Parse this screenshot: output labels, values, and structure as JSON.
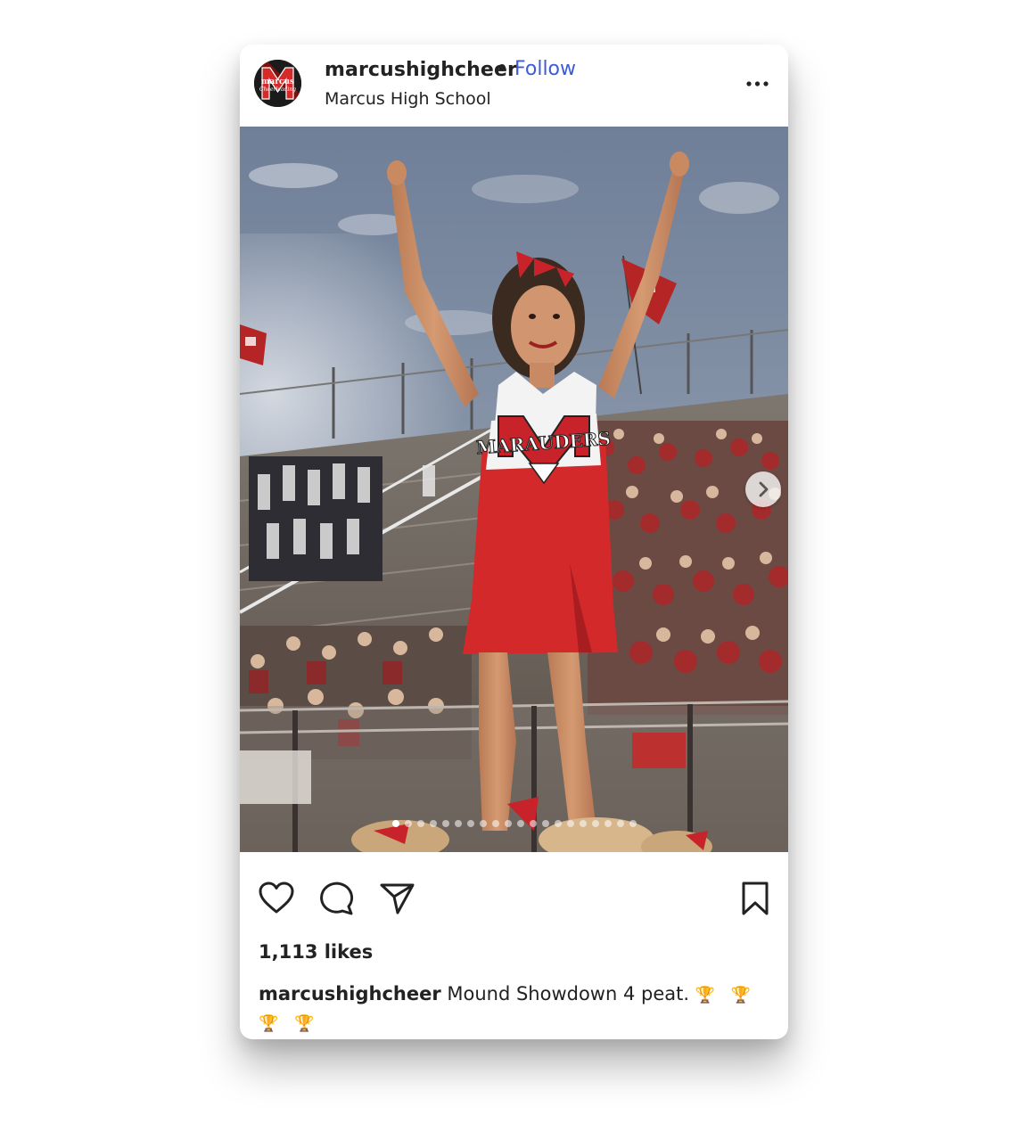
{
  "post": {
    "username": "marcushighcheer",
    "separator": "•",
    "follow_label": "Follow",
    "location": "Marcus High School",
    "more_icon": "more-options-icon",
    "likes": "1,113 likes",
    "caption_user": "marcushighcheer",
    "caption_text": "Mound Showdown 4 peat.",
    "caption_emojis": "🏆 🏆 🏆 🏆",
    "avatar_text_top": "marcus",
    "avatar_text_bottom": "Cheerleading",
    "jersey_text": "MARAUDERS",
    "carousel_count": 20,
    "carousel_active": 0
  },
  "icons": {
    "like": "heart-icon",
    "comment": "comment-icon",
    "share": "share-icon",
    "save": "bookmark-icon",
    "next": "chevron-right-icon"
  },
  "colors": {
    "follow": "#3d5bd6",
    "text": "#222222",
    "accent_red": "#d42a2a"
  }
}
